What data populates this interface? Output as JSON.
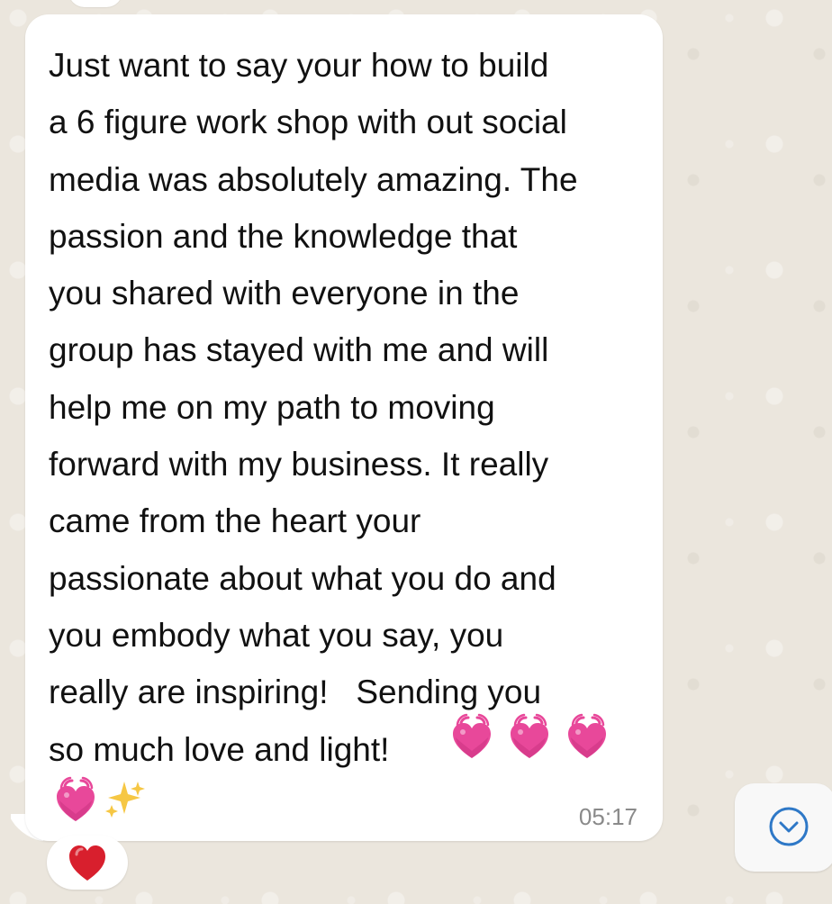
{
  "message": {
    "text": "Just want to say your how to build\na 6 figure work shop with out social\nmedia was absolutely amazing. The\npassion and the knowledge that\nyou shared with everyone in the\ngroup has stayed with me and will\nhelp me on my path to moving\nforward with my business. It really\ncame from the heart your\npassionate about what you do and\nyou embody what you say, you\nreally are inspiring!   Sending you\nso much love and light!",
    "time": "05:17",
    "emoji_sequence": [
      "growing-heart-emoji",
      "growing-heart-emoji",
      "growing-heart-emoji",
      "growing-heart-emoji",
      "sparkles-emoji"
    ]
  },
  "reaction": {
    "emoji": "red-heart-emoji",
    "count": 1
  },
  "controls": {
    "scroll_to_bottom": "chevron-down-icon"
  },
  "theme": {
    "background": "#ebe6dd",
    "bubble": "#ffffff",
    "text": "#111111",
    "timestamp": "#8a8a8a",
    "heart_pink": "#e8489a",
    "reaction_red": "#d81f2d",
    "sparkle_gold": "#f6c744",
    "accent_blue": "#2e78c7"
  }
}
